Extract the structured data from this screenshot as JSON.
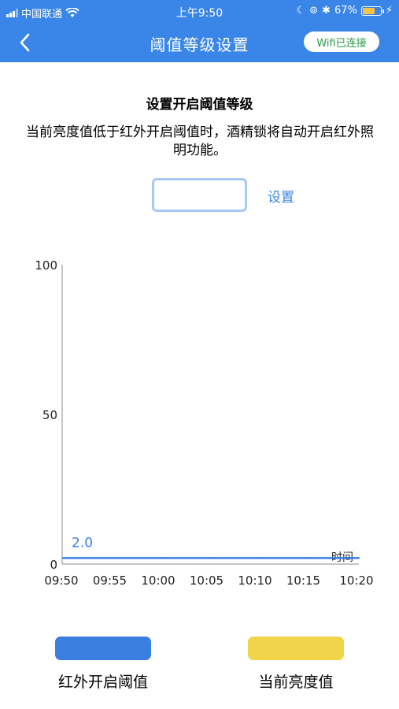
{
  "status_bar": {
    "carrier": "中国联通",
    "time": "上午9:50",
    "battery": "67%",
    "battery_level": 0.67
  },
  "nav": {
    "back_icon": "chevron-left-icon",
    "title": "阈值等级设置",
    "wifi_status": "Wifi已连接"
  },
  "content": {
    "section_title": "设置开启阈值等级",
    "description": "当前亮度值低于红外开启阈值时，酒精锁将自动开启红外照明功能。",
    "input_value": "",
    "set_label": "设置"
  },
  "colors": {
    "header_bg": "#3a86e8",
    "threshold_line": "#3a7fe0",
    "brightness_swatch": "#f0d54a"
  },
  "chart_data": {
    "type": "line",
    "x": [
      "09:50",
      "09:55",
      "10:00",
      "10:05",
      "10:10",
      "10:15",
      "10:20"
    ],
    "xlabel": "时间",
    "ylabel": "",
    "ylim": [
      0,
      100
    ],
    "yticks": [
      "0",
      "50",
      "100"
    ],
    "series": [
      {
        "name": "红外开启阈值",
        "color": "#3a7fe0",
        "values": [
          2,
          2,
          2,
          2,
          2,
          2,
          2
        ],
        "label": "2.0"
      }
    ],
    "legend": [
      {
        "label": "红外开启阈值",
        "color": "#3a7fe0"
      },
      {
        "label": "当前亮度值",
        "color": "#f0d54a"
      }
    ],
    "legend_position": "bottom"
  }
}
